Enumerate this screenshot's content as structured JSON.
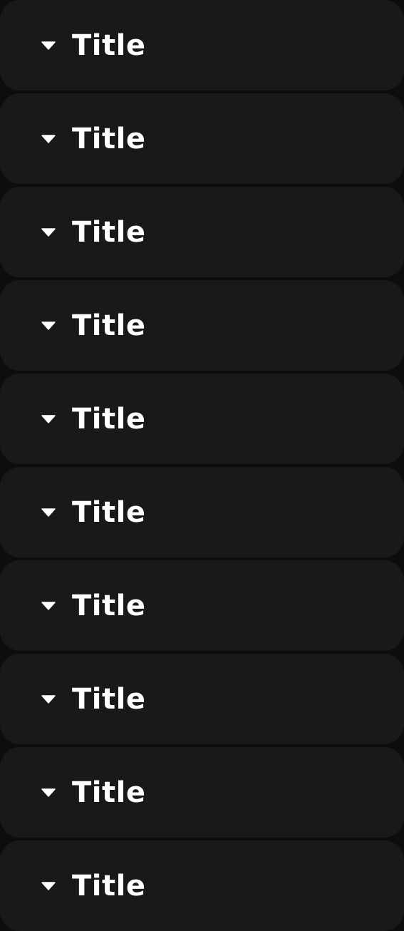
{
  "accordion": {
    "items": [
      {
        "title": "Title",
        "icon": "caret-down-icon"
      },
      {
        "title": "Title",
        "icon": "caret-down-icon"
      },
      {
        "title": "Title",
        "icon": "caret-down-icon"
      },
      {
        "title": "Title",
        "icon": "caret-down-icon"
      },
      {
        "title": "Title",
        "icon": "caret-down-icon"
      },
      {
        "title": "Title",
        "icon": "caret-down-icon"
      },
      {
        "title": "Title",
        "icon": "caret-down-icon"
      },
      {
        "title": "Title",
        "icon": "caret-down-icon"
      },
      {
        "title": "Title",
        "icon": "caret-down-icon"
      },
      {
        "title": "Title",
        "icon": "caret-down-icon"
      }
    ]
  },
  "colors": {
    "page_background": "#0d0d0d",
    "item_background": "#191919",
    "text": "#ffffff"
  }
}
